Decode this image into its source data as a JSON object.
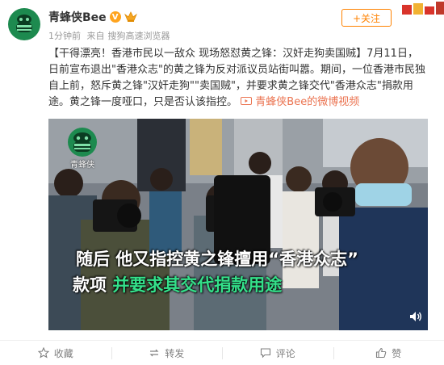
{
  "post": {
    "author": "青蜂侠Bee",
    "verified_badge": "V",
    "time": "1分钟前",
    "source_prefix": "来自",
    "source": "搜狗高速浏览器",
    "follow_label": "+关注",
    "text_main": "【干得漂亮！香港市民以一敌众 现场怒怼黄之锋：汉奸走狗卖国贼】7月11日，日前宣布退出\"香港众志\"的黄之锋为反对派议员站街叫嚣。期间，一位香港市民独自上前，怒斥黄之锋\"汉奸走狗\"\"卖国贼\"，并要求黄之锋交代\"香港众志\"捐款用途。黄之锋一度哑口，只是否认该指控。",
    "video_link": "青蜂侠Bee的微博视频"
  },
  "video": {
    "watermark": "青蜂侠",
    "subtitle_line1": "随后 他又指控黄之锋擅用“香港众志”",
    "subtitle_line2_plain": "款项 ",
    "subtitle_line2_green": "并要求其交代捐款用途"
  },
  "toolbar": {
    "collect": "收藏",
    "repost": "转发",
    "comment": "评论",
    "like": "赞"
  },
  "colors": {
    "accent": "#ff8200",
    "link": "#eb7350",
    "brand_green": "#1d8a4f"
  }
}
